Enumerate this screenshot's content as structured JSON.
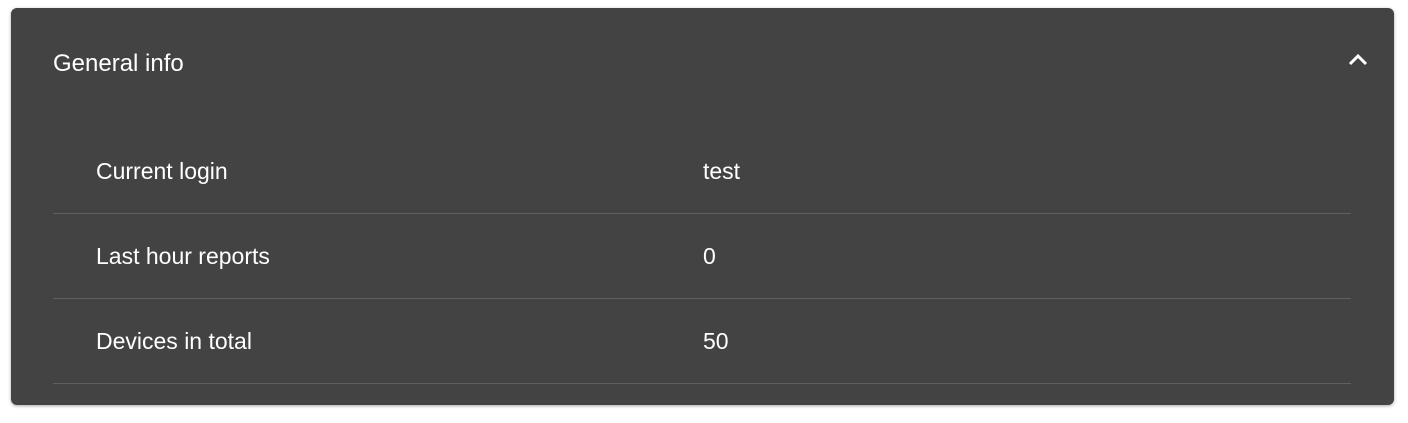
{
  "panel": {
    "title": "General info",
    "expanded": true,
    "toggle_icon": "chevron-up-icon",
    "background_color": "#434343",
    "text_color": "#ffffff",
    "divider_color": "#5f5f5f"
  },
  "info_rows": [
    {
      "label": "Current login",
      "value": "test"
    },
    {
      "label": "Last hour reports",
      "value": "0"
    },
    {
      "label": "Devices in total",
      "value": "50"
    }
  ]
}
